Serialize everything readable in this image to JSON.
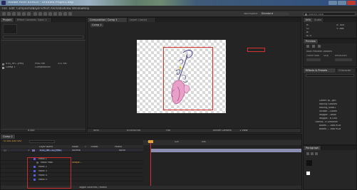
{
  "window": {
    "title": "Adobe After Effects - Untitled Project.aep",
    "workspace_label": "Workspace:",
    "workspace_value": "Standard",
    "search_placeholder": "Search Help"
  },
  "menu": [
    "File",
    "Edit",
    "Composition",
    "Layer",
    "Effect",
    "Animation",
    "View",
    "Window",
    "Help"
  ],
  "project": {
    "tabs": [
      "Project",
      "Effect Controls: Color 1",
      "Composition"
    ],
    "items": [
      {
        "name": "015_Trn...(Pi6)",
        "type": "PNG file",
        "size": "321 KB"
      },
      {
        "name": "Comp 1",
        "type": "Composition",
        "size": ""
      }
    ],
    "footer": "8 bpc"
  },
  "viewer": {
    "tab": "Composition: Comp 1",
    "tab2": "Layer: (none)",
    "comp_label": "Comp 1",
    "zoom": "50%",
    "timecode": "0:00:00:00",
    "resolution": "Full",
    "camera": "Active Camera",
    "views": "1 View"
  },
  "info": {
    "tabs": [
      "Info",
      "Audio"
    ],
    "values": [
      "R:",
      "G:",
      "B:",
      "A: 0"
    ],
    "coords": [
      "X: 404",
      "Y: 366"
    ]
  },
  "preview": {
    "tab": "Preview",
    "ram_label": "RAM Preview Options",
    "frame_rate": "Frame Rate",
    "skip": "Skip",
    "resolution": "Resolution"
  },
  "effects": {
    "tab": "Effects & Presets",
    "tab2": "Character",
    "items": [
      "Lorem ip...ght",
      "Rolling Strokes",
      "Rolling_slide1",
      "Strobe ...Down",
      "Wiggle ...ation",
      "Wiggle - a Link",
      "Transit...k Dissolve",
      "Boxes ... Add RGB",
      "Boxes ... Add RGB"
    ]
  },
  "paragraph": {
    "tab": "Paragraph"
  },
  "timeline": {
    "tab": "Comp 1",
    "timecode": "0:00:00:00",
    "headers": [
      "Layer Name",
      "Mode",
      "T",
      "TrkMat",
      "Parent"
    ],
    "layers": [
      {
        "num": "1",
        "name": "015_Tre...22_PNG"
      },
      {
        "name": "Mask 1"
      },
      {
        "name": "Mask Path",
        "value": "Shape..."
      },
      {
        "name": "Mask 2"
      },
      {
        "name": "Mask 3"
      },
      {
        "name": "Mask 4"
      },
      {
        "name": "Mask 5"
      }
    ],
    "mode": "Normal",
    "parent": "None",
    "ruler": [
      "00s",
      "02s",
      "04s"
    ],
    "footer": "Toggle Switches / Modes"
  },
  "colors": {
    "accent_red": "#d63030",
    "timecode": "#e8a23a",
    "work_area": "#8a8fb2"
  }
}
